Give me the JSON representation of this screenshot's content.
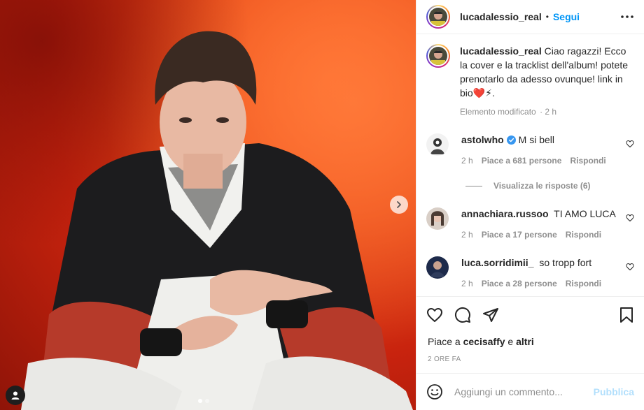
{
  "post": {
    "author": "lucadalessio_real",
    "separator": "•",
    "follow_label": "Segui",
    "more_icon": "more-horizontal-icon"
  },
  "caption": {
    "username": "lucadalessio_real",
    "text": "Ciao ragazzi! Ecco la cover e la tracklist dell'album! potete prenotarlo da adesso ovunque! link in bio❤️⚡.",
    "meta_label": "Elemento modificato",
    "meta_sep": "·",
    "meta_time": "2 h"
  },
  "comments": [
    {
      "username": "astolwho",
      "verified": true,
      "text": "M si bell",
      "time": "2 h",
      "likes": "Piace a 681 persone",
      "reply": "Rispondi",
      "view_replies": "Visualizza le risposte (6)"
    },
    {
      "username": "annachiara.russoo",
      "verified": false,
      "text": "TI AMO LUCA",
      "time": "2 h",
      "likes": "Piace a 17 persone",
      "reply": "Rispondi"
    },
    {
      "username": "luca.sorridimii_",
      "verified": false,
      "text": "so tropp fort",
      "time": "2 h",
      "likes": "Piace a 28 persone",
      "reply": "Rispondi"
    }
  ],
  "likes": {
    "prefix": "Piace a",
    "user": "cecisaffy",
    "joiner": "e",
    "others": "altri"
  },
  "time_ago": "2 ORE FA",
  "add_comment": {
    "placeholder": "Aggiungi un commento...",
    "publish_label": "Pubblica"
  },
  "carousel": {
    "current_slide": 1,
    "total_slides": 2
  },
  "colors": {
    "accent": "#0095f6",
    "publish_disabled": "#b2dffc",
    "muted": "#8e8e8e",
    "text": "#262626"
  }
}
